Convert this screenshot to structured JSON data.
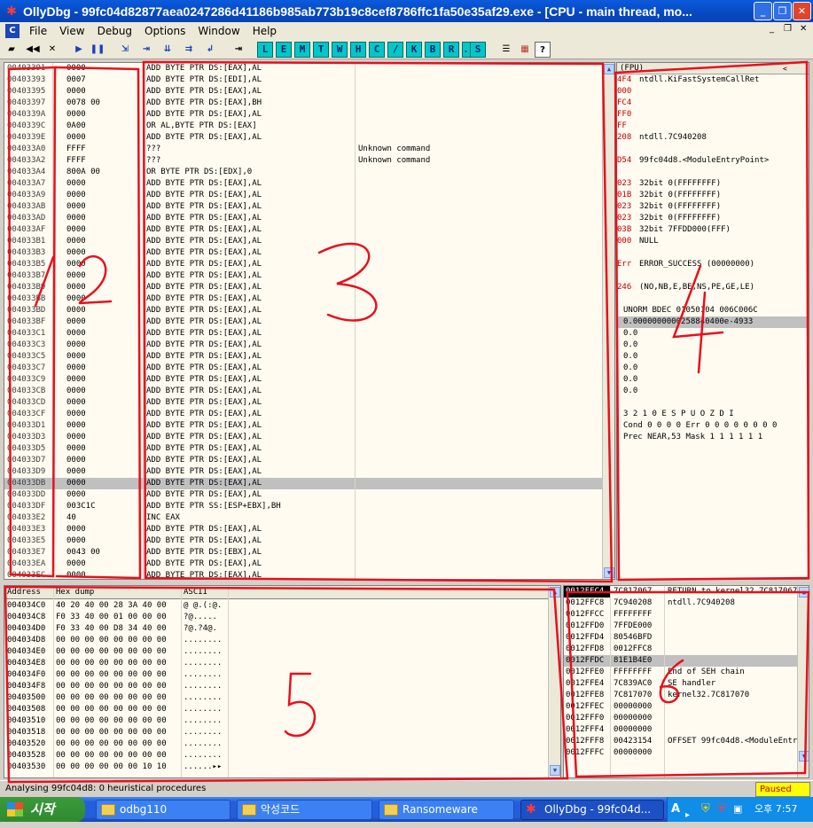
{
  "window": {
    "title": "OllyDbg - 99fc04d82877aea0247286d41186b985ab773b19c8cef8786ffc1fa50e35af29.exe - [CPU - main thread, mo..."
  },
  "menu": [
    "File",
    "View",
    "Debug",
    "Options",
    "Window",
    "Help"
  ],
  "toolbar_letters": [
    "L",
    "E",
    "M",
    "T",
    "W",
    "H",
    "C",
    "/",
    "K",
    "B",
    "R",
    "...",
    "S"
  ],
  "disasm": {
    "rows": [
      [
        "00403391",
        "0000",
        "ADD BYTE PTR DS:[EAX],AL",
        ""
      ],
      [
        "00403393",
        "0007",
        "ADD BYTE PTR DS:[EDI],AL",
        ""
      ],
      [
        "00403395",
        "0000",
        "ADD BYTE PTR DS:[EAX],AL",
        ""
      ],
      [
        "00403397",
        "0078 00",
        "ADD BYTE PTR DS:[EAX],BH",
        ""
      ],
      [
        "0040339A",
        "0000",
        "ADD BYTE PTR DS:[EAX],AL",
        ""
      ],
      [
        "0040339C",
        "0A00",
        "OR AL,BYTE PTR DS:[EAX]",
        ""
      ],
      [
        "0040339E",
        "0000",
        "ADD BYTE PTR DS:[EAX],AL",
        ""
      ],
      [
        "004033A0",
        "FFFF",
        "???",
        "Unknown command"
      ],
      [
        "004033A2",
        "FFFF",
        "???",
        "Unknown command"
      ],
      [
        "004033A4",
        "800A 00",
        "OR BYTE PTR DS:[EDX],0",
        ""
      ],
      [
        "004033A7",
        "0000",
        "ADD BYTE PTR DS:[EAX],AL",
        ""
      ],
      [
        "004033A9",
        "0000",
        "ADD BYTE PTR DS:[EAX],AL",
        ""
      ],
      [
        "004033AB",
        "0000",
        "ADD BYTE PTR DS:[EAX],AL",
        ""
      ],
      [
        "004033AD",
        "0000",
        "ADD BYTE PTR DS:[EAX],AL",
        ""
      ],
      [
        "004033AF",
        "0000",
        "ADD BYTE PTR DS:[EAX],AL",
        ""
      ],
      [
        "004033B1",
        "0000",
        "ADD BYTE PTR DS:[EAX],AL",
        ""
      ],
      [
        "004033B3",
        "0000",
        "ADD BYTE PTR DS:[EAX],AL",
        ""
      ],
      [
        "004033B5",
        "0000",
        "ADD BYTE PTR DS:[EAX],AL",
        ""
      ],
      [
        "004033B7",
        "0000",
        "ADD BYTE PTR DS:[EAX],AL",
        ""
      ],
      [
        "004033B9",
        "0000",
        "ADD BYTE PTR DS:[EAX],AL",
        ""
      ],
      [
        "004033BB",
        "0000",
        "ADD BYTE PTR DS:[EAX],AL",
        ""
      ],
      [
        "004033BD",
        "0000",
        "ADD BYTE PTR DS:[EAX],AL",
        ""
      ],
      [
        "004033BF",
        "0000",
        "ADD BYTE PTR DS:[EAX],AL",
        ""
      ],
      [
        "004033C1",
        "0000",
        "ADD BYTE PTR DS:[EAX],AL",
        ""
      ],
      [
        "004033C3",
        "0000",
        "ADD BYTE PTR DS:[EAX],AL",
        ""
      ],
      [
        "004033C5",
        "0000",
        "ADD BYTE PTR DS:[EAX],AL",
        ""
      ],
      [
        "004033C7",
        "0000",
        "ADD BYTE PTR DS:[EAX],AL",
        ""
      ],
      [
        "004033C9",
        "0000",
        "ADD BYTE PTR DS:[EAX],AL",
        ""
      ],
      [
        "004033CB",
        "0000",
        "ADD BYTE PTR DS:[EAX],AL",
        ""
      ],
      [
        "004033CD",
        "0000",
        "ADD BYTE PTR DS:[EAX],AL",
        ""
      ],
      [
        "004033CF",
        "0000",
        "ADD BYTE PTR DS:[EAX],AL",
        ""
      ],
      [
        "004033D1",
        "0000",
        "ADD BYTE PTR DS:[EAX],AL",
        ""
      ],
      [
        "004033D3",
        "0000",
        "ADD BYTE PTR DS:[EAX],AL",
        ""
      ],
      [
        "004033D5",
        "0000",
        "ADD BYTE PTR DS:[EAX],AL",
        ""
      ],
      [
        "004033D7",
        "0000",
        "ADD BYTE PTR DS:[EAX],AL",
        ""
      ],
      [
        "004033D9",
        "0000",
        "ADD BYTE PTR DS:[EAX],AL",
        ""
      ],
      [
        "004033DB",
        "0000",
        "ADD BYTE PTR DS:[EAX],AL",
        ""
      ],
      [
        "004033DD",
        "0000",
        "ADD BYTE PTR DS:[EAX],AL",
        ""
      ],
      [
        "004033DF",
        "003C1C",
        "ADD BYTE PTR SS:[ESP+EBX],BH",
        ""
      ],
      [
        "004033E2",
        "40",
        "INC EAX",
        ""
      ],
      [
        "004033E3",
        "0000",
        "ADD BYTE PTR DS:[EAX],AL",
        ""
      ],
      [
        "004033E5",
        "0000",
        "ADD BYTE PTR DS:[EAX],AL",
        ""
      ],
      [
        "004033E7",
        "0043 00",
        "ADD BYTE PTR DS:[EBX],AL",
        ""
      ],
      [
        "004033EA",
        "0000",
        "ADD BYTE PTR DS:[EAX],AL",
        ""
      ],
      [
        "004033EC",
        "0000",
        "ADD BYTE PTR DS:[EAX],AL",
        ""
      ]
    ],
    "selected_index": 36
  },
  "registers": {
    "header": "(FPU)",
    "lines": [
      [
        "4F4",
        "ntdll.KiFastSystemCallRet"
      ],
      [
        "000",
        ""
      ],
      [
        "FC4",
        ""
      ],
      [
        "FF0",
        ""
      ],
      [
        "FF",
        ""
      ],
      [
        "208",
        "ntdll.7C940208"
      ],
      [
        "",
        ""
      ],
      [
        "D54",
        "99fc04d8.<ModuleEntryPoint>"
      ],
      [
        "",
        ""
      ],
      [
        "023",
        "32bit 0(FFFFFFFF)"
      ],
      [
        "01B",
        "32bit 0(FFFFFFFF)"
      ],
      [
        "023",
        "32bit 0(FFFFFFFF)"
      ],
      [
        "023",
        "32bit 0(FFFFFFFF)"
      ],
      [
        "03B",
        "32bit 7FFDD000(FFF)"
      ],
      [
        "000",
        "NULL"
      ],
      [
        "",
        ""
      ],
      [
        "Err",
        "ERROR_SUCCESS (00000000)"
      ],
      [
        "",
        ""
      ],
      [
        "246",
        "(NO,NB,E,BE,NS,PE,GE,LE)"
      ],
      [
        "",
        ""
      ],
      [
        "",
        "UNORM BDEC 01050104 006C006C"
      ],
      [
        "",
        "0.0000000000258840400e-4933"
      ],
      [
        "",
        "0.0"
      ],
      [
        "",
        "0.0"
      ],
      [
        "",
        "0.0"
      ],
      [
        "",
        "0.0"
      ],
      [
        "",
        "0.0"
      ],
      [
        "",
        "0.0"
      ],
      [
        "",
        ""
      ],
      [
        "",
        "  3 2 1 0      E S P U O Z D I"
      ],
      [
        "",
        "Cond 0 0 0 0  Err 0 0 0 0 0 0 0 0"
      ],
      [
        "",
        "Prec NEAR,53  Mask    1 1 1 1 1 1"
      ]
    ]
  },
  "dump": {
    "headers": [
      "Address",
      "Hex dump",
      "ASCII"
    ],
    "rows": [
      [
        "004034C0",
        "40 20 40 00 28 3A 40 00",
        "@ @.(:@."
      ],
      [
        "004034C8",
        "F0 33 40 00 01 00 00 00",
        "?@....."
      ],
      [
        "004034D0",
        "F0 33 40 00 D8 34 40 00",
        "?@.?4@."
      ],
      [
        "004034D8",
        "00 00 00 00 00 00 00 00",
        "........"
      ],
      [
        "004034E0",
        "00 00 00 00 00 00 00 00",
        "........"
      ],
      [
        "004034E8",
        "00 00 00 00 00 00 00 00",
        "........"
      ],
      [
        "004034F0",
        "00 00 00 00 00 00 00 00",
        "........"
      ],
      [
        "004034F8",
        "00 00 00 00 00 00 00 00",
        "........"
      ],
      [
        "00403500",
        "00 00 00 00 00 00 00 00",
        "........"
      ],
      [
        "00403508",
        "00 00 00 00 00 00 00 00",
        "........"
      ],
      [
        "00403510",
        "00 00 00 00 00 00 00 00",
        "........"
      ],
      [
        "00403518",
        "00 00 00 00 00 00 00 00",
        "........"
      ],
      [
        "00403520",
        "00 00 00 00 00 00 00 00",
        "........"
      ],
      [
        "00403528",
        "00 00 00 00 00 00 00 00",
        "........"
      ],
      [
        "00403530",
        "00 00 00 00 00 00 10 10",
        "......▸▸"
      ]
    ]
  },
  "stack": {
    "rows": [
      [
        "0012FFC4",
        "7C817067",
        "RETURN to kernel32.7C817067"
      ],
      [
        "0012FFC8",
        "7C940208",
        "ntdll.7C940208"
      ],
      [
        "0012FFCC",
        "FFFFFFFF",
        ""
      ],
      [
        "0012FFD0",
        "7FFDE000",
        ""
      ],
      [
        "0012FFD4",
        "80546BFD",
        ""
      ],
      [
        "0012FFD8",
        "0012FFC8",
        ""
      ],
      [
        "0012FFDC",
        "81E1B4E0",
        ""
      ],
      [
        "0012FFE0",
        "FFFFFFFF",
        "End of SEH chain"
      ],
      [
        "0012FFE4",
        "7C839AC0",
        "SE handler"
      ],
      [
        "0012FFE8",
        "7C817070",
        "kernel32.7C817070"
      ],
      [
        "0012FFEC",
        "00000000",
        ""
      ],
      [
        "0012FFF0",
        "00000000",
        ""
      ],
      [
        "0012FFF4",
        "00000000",
        ""
      ],
      [
        "0012FFF8",
        "00423154",
        "OFFSET 99fc04d8.<ModuleEntryPoint>"
      ],
      [
        "0012FFFC",
        "00000000",
        ""
      ]
    ],
    "selected_index": 6
  },
  "status": {
    "text": "Analysing 99fc04d8: 0 heuristical procedures",
    "state": "Paused"
  },
  "taskbar": {
    "start": "시작",
    "tasks": [
      "odbg110",
      "악성코드",
      "Ransomeware",
      "OllyDbg - 99fc04d..."
    ],
    "tray_lang": "A",
    "clock": "오후 7:57"
  },
  "annotations": [
    "1",
    "2",
    "3",
    "4",
    "5",
    "6"
  ],
  "colors": {
    "selection": "#c0c0c0",
    "annotation": "#e8101e",
    "pane_bg": "#fffbf0",
    "paused": "#ffff00"
  }
}
